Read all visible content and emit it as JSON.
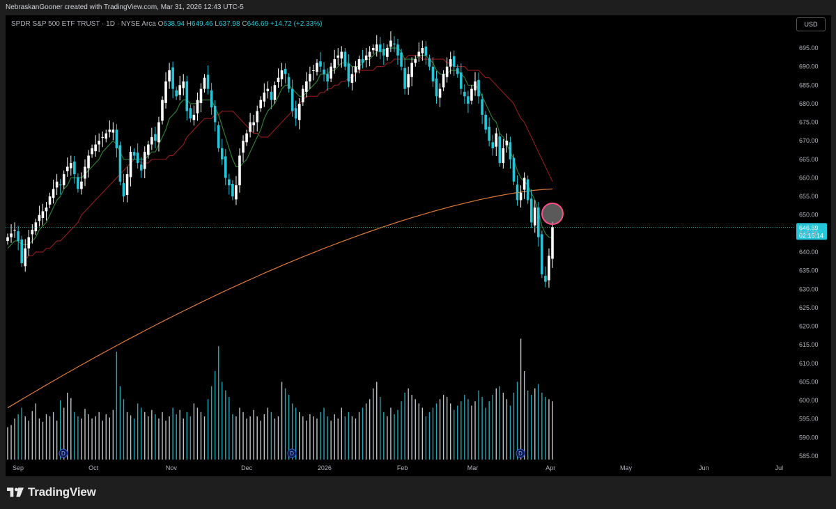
{
  "header": {
    "attribution": "NebraskanGooner created with TradingView.com, Mar 31, 2026 12:43 UTC-5"
  },
  "legend": {
    "symbol": "SPDR S&P 500 ETF TRUST · 1D · NYSE Arca",
    "o_label": "O",
    "o_value": "638.94",
    "h_label": "H",
    "h_value": "649.46",
    "l_label": "L",
    "l_value": "637.98",
    "c_label": "C",
    "c_value": "646.69",
    "change": "+14.72 (+2.33%)"
  },
  "currency_button": "USD",
  "price_tag": {
    "price": "646.69",
    "countdown": "02:16:14"
  },
  "footer": {
    "brand": "TradingView"
  },
  "colors": {
    "up": "#ffffff",
    "down": "#26c6da",
    "ma_fast": "#2e7d32",
    "ma_mid": "#8b1a1a",
    "ma_slow": "#e07b39",
    "highlight_circle": "#ff4d8a"
  },
  "chart_data": {
    "type": "candlestick",
    "title": "",
    "y_ticks": [
      "695.00",
      "690.00",
      "685.00",
      "680.00",
      "675.00",
      "670.00",
      "665.00",
      "660.00",
      "655.00",
      "650.00",
      "645.00",
      "640.00",
      "635.00",
      "630.00",
      "625.00",
      "620.00",
      "615.00",
      "610.00",
      "605.00",
      "600.00",
      "595.00",
      "590.00",
      "585.00"
    ],
    "ylim": [
      583,
      699
    ],
    "x_labels": [
      {
        "label": "Sep",
        "date": "2025-09-01"
      },
      {
        "label": "Oct",
        "date": "2025-10-01"
      },
      {
        "label": "Nov",
        "date": "2025-11-01"
      },
      {
        "label": "Dec",
        "date": "2025-12-01"
      },
      {
        "label": "2026",
        "date": "2026-01-01"
      },
      {
        "label": "Feb",
        "date": "2026-02-01"
      },
      {
        "label": "Mar",
        "date": "2026-03-01"
      },
      {
        "label": "Apr",
        "date": "2026-04-01"
      },
      {
        "label": "May",
        "date": "2026-05-01"
      },
      {
        "label": "Jun",
        "date": "2026-06-01"
      },
      {
        "label": "Jul",
        "date": "2026-07-01"
      }
    ],
    "date_range": [
      "2025-08-27",
      "2026-07-07"
    ],
    "last_close": 646.69,
    "dividend_markers": [
      {
        "label": "D",
        "date": "2025-09-19"
      },
      {
        "label": "D",
        "date": "2025-12-19"
      },
      {
        "label": "D",
        "date": "2026-03-20"
      }
    ],
    "closes": [
      644,
      645,
      646,
      643,
      637,
      641,
      644,
      646,
      648,
      650,
      651,
      652,
      655,
      657,
      659,
      658,
      661,
      663,
      664,
      661,
      657,
      659,
      663,
      666,
      668,
      669,
      670,
      671,
      672,
      673,
      673,
      668,
      659,
      655,
      661,
      667,
      666,
      664,
      662,
      667,
      669,
      671,
      670,
      675,
      681,
      686,
      689,
      684,
      682,
      685,
      686,
      678,
      676,
      677,
      681,
      684,
      687,
      684,
      679,
      675,
      668,
      665,
      660,
      658,
      655,
      658,
      666,
      670,
      672,
      675,
      675,
      678,
      681,
      683,
      684,
      681,
      685,
      687,
      689,
      688,
      684,
      678,
      676,
      680,
      684,
      686,
      688,
      689,
      691,
      690,
      688,
      686,
      690,
      692,
      693,
      694,
      690,
      686,
      688,
      690,
      692,
      691,
      693,
      694,
      695,
      696,
      694,
      693,
      695,
      697,
      696,
      693,
      690,
      684,
      688,
      691,
      692,
      694,
      695,
      693,
      690,
      686,
      682,
      684,
      688,
      690,
      692,
      690,
      688,
      684,
      682,
      680,
      684,
      686,
      682,
      677,
      673,
      670,
      668,
      672,
      664,
      668,
      670,
      665,
      659,
      654,
      656,
      660,
      654,
      648,
      652,
      644,
      634,
      632,
      639,
      646.69
    ],
    "ma_fast": [
      641,
      642,
      643,
      643,
      642,
      642,
      642,
      643,
      644,
      646,
      647,
      648,
      650,
      652,
      654,
      655,
      657,
      658,
      660,
      660,
      660,
      660,
      661,
      662,
      663,
      664,
      665,
      667,
      668,
      669,
      670,
      669,
      667,
      665,
      665,
      665,
      665,
      665,
      665,
      665,
      666,
      667,
      667,
      669,
      671,
      673,
      676,
      677,
      678,
      680,
      681,
      681,
      680,
      680,
      680,
      681,
      681,
      681,
      681,
      679,
      677,
      674,
      671,
      668,
      665,
      663,
      663,
      664,
      665,
      667,
      669,
      671,
      673,
      676,
      678,
      679,
      680,
      682,
      684,
      685,
      685,
      684,
      683,
      682,
      682,
      683,
      684,
      685,
      686,
      688,
      688,
      688,
      689,
      689,
      690,
      691,
      691,
      691,
      690,
      690,
      690,
      691,
      692,
      692,
      693,
      694,
      694,
      694,
      695,
      695,
      695,
      695,
      694,
      692,
      692,
      692,
      692,
      693,
      693,
      693,
      692,
      691,
      689,
      688,
      688,
      688,
      689,
      689,
      689,
      688,
      687,
      685,
      685,
      685,
      684,
      682,
      680,
      678,
      676,
      675,
      672,
      671,
      669,
      667,
      665,
      662,
      660,
      659,
      658,
      656,
      654,
      651,
      647,
      645,
      644,
      644
    ],
    "ma_mid": [
      638,
      639,
      639,
      640,
      640,
      640,
      641,
      641,
      642,
      643,
      643,
      644,
      645,
      646,
      647,
      648,
      650,
      651,
      652,
      653,
      654,
      655,
      656,
      657,
      658,
      659,
      660,
      661,
      662,
      663,
      664,
      665,
      665,
      664,
      664,
      664,
      665,
      665,
      665,
      665,
      665,
      666,
      666,
      667,
      668,
      669,
      671,
      672,
      673,
      674,
      675,
      676,
      676,
      676,
      677,
      677,
      678,
      678,
      678,
      678,
      677,
      676,
      675,
      674,
      673,
      672,
      672,
      671,
      671,
      671,
      672,
      673,
      674,
      675,
      676,
      677,
      678,
      679,
      680,
      681,
      682,
      682,
      682,
      682,
      683,
      683,
      684,
      684,
      685,
      685,
      686,
      686,
      687,
      687,
      688,
      689,
      689,
      689,
      689,
      689,
      690,
      690,
      690,
      691,
      691,
      692,
      692,
      692,
      692,
      693,
      693,
      693,
      693,
      692,
      692,
      692,
      692,
      692,
      692,
      692,
      691,
      691,
      690,
      690,
      690,
      690,
      689,
      689,
      689,
      689,
      688,
      687,
      687,
      686,
      685,
      684,
      683,
      682,
      681,
      680,
      678,
      676,
      675,
      673,
      671,
      669,
      667,
      665,
      663,
      661,
      659
    ],
    "ma_slow": [
      592,
      593,
      594,
      595,
      596,
      597,
      598,
      599,
      600,
      601,
      602,
      603,
      604,
      605,
      606,
      607,
      608,
      609,
      610,
      611,
      612,
      613,
      614,
      615,
      616,
      617,
      618,
      619,
      620,
      621,
      622,
      623,
      624,
      625,
      626,
      627,
      628,
      629,
      630,
      631,
      632,
      633,
      634,
      635,
      636,
      637,
      637.8,
      638.6,
      639.4,
      640.2,
      641,
      641.8,
      642.6,
      643.4,
      644.2,
      645,
      645.8,
      646.6,
      647.4,
      648.2,
      649,
      649.8,
      650.6,
      651.4,
      652.2,
      653,
      653.8,
      654.6,
      655.4,
      656.2,
      657
    ],
    "volumes": [
      0.3,
      0.32,
      0.38,
      0.42,
      0.48,
      0.4,
      0.36,
      0.45,
      0.52,
      0.38,
      0.35,
      0.42,
      0.4,
      0.44,
      0.36,
      0.55,
      0.48,
      0.62,
      0.57,
      0.44,
      0.4,
      0.38,
      0.47,
      0.42,
      0.38,
      0.4,
      0.44,
      0.36,
      0.42,
      0.39,
      0.46,
      1.0,
      0.68,
      0.56,
      0.44,
      0.41,
      0.38,
      0.52,
      0.48,
      0.44,
      0.4,
      0.46,
      0.42,
      0.38,
      0.44,
      0.36,
      0.4,
      0.48,
      0.42,
      0.46,
      0.38,
      0.44,
      0.4,
      0.52,
      0.48,
      0.44,
      0.4,
      0.56,
      0.68,
      0.82,
      1.05,
      0.72,
      0.64,
      0.58,
      0.42,
      0.4,
      0.48,
      0.44,
      0.38,
      0.4,
      0.46,
      0.4,
      0.36,
      0.42,
      0.48,
      0.44,
      0.38,
      0.4,
      0.72,
      0.66,
      0.6,
      0.52,
      0.48,
      0.44,
      0.4,
      0.36,
      0.42,
      0.4,
      0.38,
      0.44,
      0.48,
      0.4,
      0.36,
      0.42,
      0.38,
      0.48,
      0.4,
      0.44,
      0.4,
      0.38,
      0.44,
      0.48,
      0.52,
      0.56,
      0.66,
      0.72,
      0.58,
      0.44,
      0.4,
      0.48,
      0.42,
      0.46,
      0.54,
      0.62,
      0.66,
      0.6,
      0.56,
      0.52,
      0.48,
      0.4,
      0.44,
      0.48,
      0.52,
      0.56,
      0.6,
      0.58,
      0.52,
      0.46,
      0.5,
      0.54,
      0.6,
      0.56,
      0.5,
      0.54,
      0.64,
      0.58,
      0.48,
      0.54,
      0.6,
      0.66,
      0.68,
      0.62,
      0.56,
      0.5,
      0.62,
      0.72,
      1.12,
      0.82,
      0.64,
      0.6,
      0.66,
      0.7,
      0.62,
      0.58,
      0.56,
      0.54
    ]
  }
}
